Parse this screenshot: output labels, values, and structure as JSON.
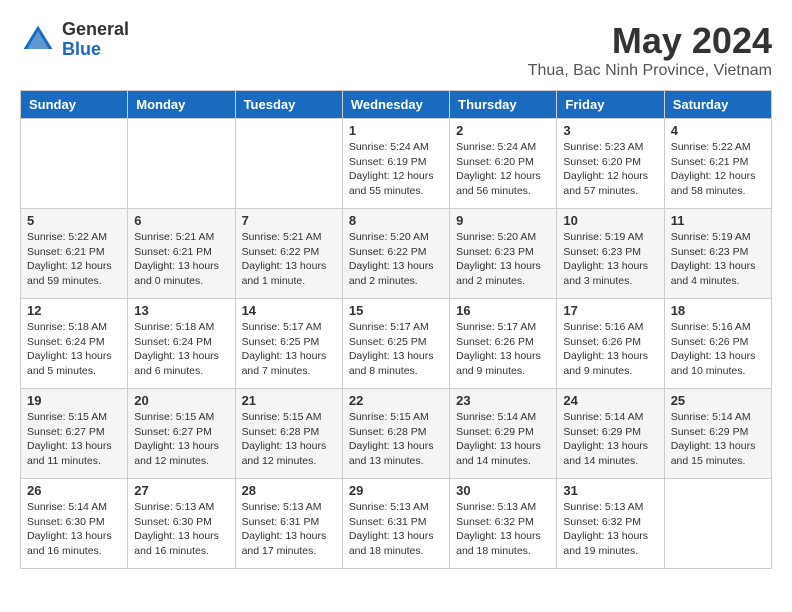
{
  "header": {
    "logo_general": "General",
    "logo_blue": "Blue",
    "month_year": "May 2024",
    "location": "Thua, Bac Ninh Province, Vietnam"
  },
  "weekdays": [
    "Sunday",
    "Monday",
    "Tuesday",
    "Wednesday",
    "Thursday",
    "Friday",
    "Saturday"
  ],
  "rows": [
    [
      {
        "day": "",
        "info": ""
      },
      {
        "day": "",
        "info": ""
      },
      {
        "day": "",
        "info": ""
      },
      {
        "day": "1",
        "info": "Sunrise: 5:24 AM\nSunset: 6:19 PM\nDaylight: 12 hours\nand 55 minutes."
      },
      {
        "day": "2",
        "info": "Sunrise: 5:24 AM\nSunset: 6:20 PM\nDaylight: 12 hours\nand 56 minutes."
      },
      {
        "day": "3",
        "info": "Sunrise: 5:23 AM\nSunset: 6:20 PM\nDaylight: 12 hours\nand 57 minutes."
      },
      {
        "day": "4",
        "info": "Sunrise: 5:22 AM\nSunset: 6:21 PM\nDaylight: 12 hours\nand 58 minutes."
      }
    ],
    [
      {
        "day": "5",
        "info": "Sunrise: 5:22 AM\nSunset: 6:21 PM\nDaylight: 12 hours\nand 59 minutes."
      },
      {
        "day": "6",
        "info": "Sunrise: 5:21 AM\nSunset: 6:21 PM\nDaylight: 13 hours\nand 0 minutes."
      },
      {
        "day": "7",
        "info": "Sunrise: 5:21 AM\nSunset: 6:22 PM\nDaylight: 13 hours\nand 1 minute."
      },
      {
        "day": "8",
        "info": "Sunrise: 5:20 AM\nSunset: 6:22 PM\nDaylight: 13 hours\nand 2 minutes."
      },
      {
        "day": "9",
        "info": "Sunrise: 5:20 AM\nSunset: 6:23 PM\nDaylight: 13 hours\nand 2 minutes."
      },
      {
        "day": "10",
        "info": "Sunrise: 5:19 AM\nSunset: 6:23 PM\nDaylight: 13 hours\nand 3 minutes."
      },
      {
        "day": "11",
        "info": "Sunrise: 5:19 AM\nSunset: 6:23 PM\nDaylight: 13 hours\nand 4 minutes."
      }
    ],
    [
      {
        "day": "12",
        "info": "Sunrise: 5:18 AM\nSunset: 6:24 PM\nDaylight: 13 hours\nand 5 minutes."
      },
      {
        "day": "13",
        "info": "Sunrise: 5:18 AM\nSunset: 6:24 PM\nDaylight: 13 hours\nand 6 minutes."
      },
      {
        "day": "14",
        "info": "Sunrise: 5:17 AM\nSunset: 6:25 PM\nDaylight: 13 hours\nand 7 minutes."
      },
      {
        "day": "15",
        "info": "Sunrise: 5:17 AM\nSunset: 6:25 PM\nDaylight: 13 hours\nand 8 minutes."
      },
      {
        "day": "16",
        "info": "Sunrise: 5:17 AM\nSunset: 6:26 PM\nDaylight: 13 hours\nand 9 minutes."
      },
      {
        "day": "17",
        "info": "Sunrise: 5:16 AM\nSunset: 6:26 PM\nDaylight: 13 hours\nand 9 minutes."
      },
      {
        "day": "18",
        "info": "Sunrise: 5:16 AM\nSunset: 6:26 PM\nDaylight: 13 hours\nand 10 minutes."
      }
    ],
    [
      {
        "day": "19",
        "info": "Sunrise: 5:15 AM\nSunset: 6:27 PM\nDaylight: 13 hours\nand 11 minutes."
      },
      {
        "day": "20",
        "info": "Sunrise: 5:15 AM\nSunset: 6:27 PM\nDaylight: 13 hours\nand 12 minutes."
      },
      {
        "day": "21",
        "info": "Sunrise: 5:15 AM\nSunset: 6:28 PM\nDaylight: 13 hours\nand 12 minutes."
      },
      {
        "day": "22",
        "info": "Sunrise: 5:15 AM\nSunset: 6:28 PM\nDaylight: 13 hours\nand 13 minutes."
      },
      {
        "day": "23",
        "info": "Sunrise: 5:14 AM\nSunset: 6:29 PM\nDaylight: 13 hours\nand 14 minutes."
      },
      {
        "day": "24",
        "info": "Sunrise: 5:14 AM\nSunset: 6:29 PM\nDaylight: 13 hours\nand 14 minutes."
      },
      {
        "day": "25",
        "info": "Sunrise: 5:14 AM\nSunset: 6:29 PM\nDaylight: 13 hours\nand 15 minutes."
      }
    ],
    [
      {
        "day": "26",
        "info": "Sunrise: 5:14 AM\nSunset: 6:30 PM\nDaylight: 13 hours\nand 16 minutes."
      },
      {
        "day": "27",
        "info": "Sunrise: 5:13 AM\nSunset: 6:30 PM\nDaylight: 13 hours\nand 16 minutes."
      },
      {
        "day": "28",
        "info": "Sunrise: 5:13 AM\nSunset: 6:31 PM\nDaylight: 13 hours\nand 17 minutes."
      },
      {
        "day": "29",
        "info": "Sunrise: 5:13 AM\nSunset: 6:31 PM\nDaylight: 13 hours\nand 18 minutes."
      },
      {
        "day": "30",
        "info": "Sunrise: 5:13 AM\nSunset: 6:32 PM\nDaylight: 13 hours\nand 18 minutes."
      },
      {
        "day": "31",
        "info": "Sunrise: 5:13 AM\nSunset: 6:32 PM\nDaylight: 13 hours\nand 19 minutes."
      },
      {
        "day": "",
        "info": ""
      }
    ]
  ]
}
